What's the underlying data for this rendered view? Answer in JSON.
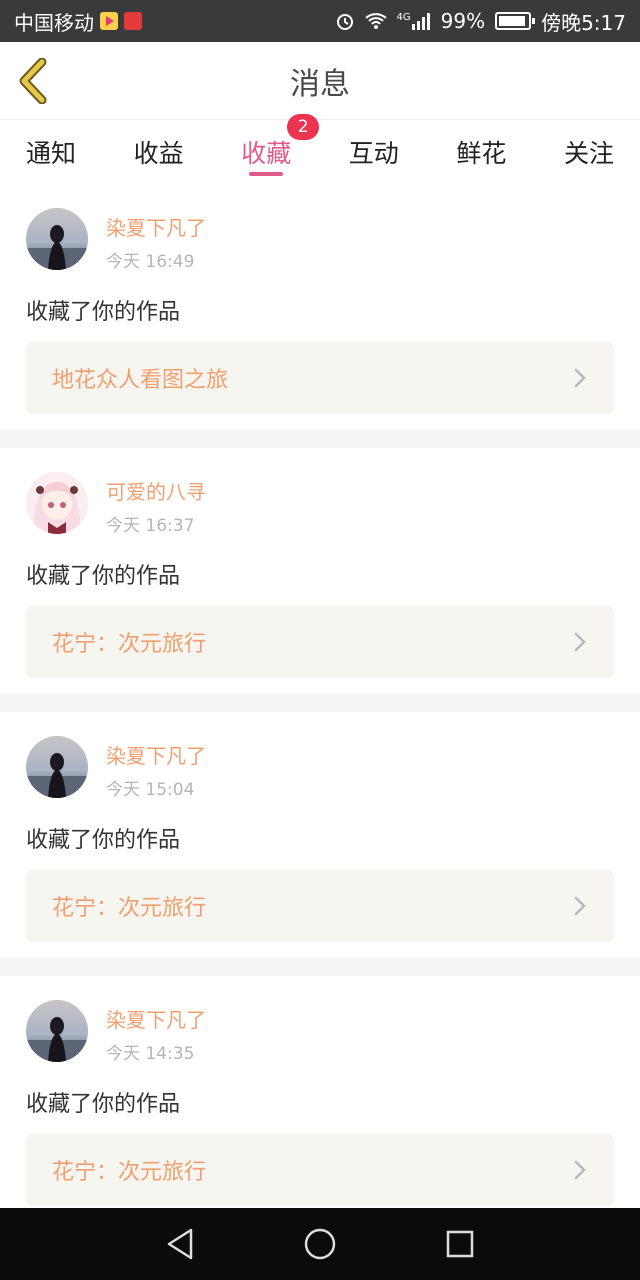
{
  "status_bar": {
    "carrier": "中国移动",
    "network": "4G",
    "battery": "99%",
    "time": "傍晚5:17"
  },
  "header": {
    "title": "消息"
  },
  "tabs": [
    {
      "label": "通知"
    },
    {
      "label": "收益"
    },
    {
      "label": "收藏",
      "badge": "2",
      "active": true
    },
    {
      "label": "互动"
    },
    {
      "label": "鲜花"
    },
    {
      "label": "关注"
    }
  ],
  "feed": [
    {
      "username": "染夏下凡了",
      "time": "今天 16:49",
      "action": "收藏了你的作品",
      "work": "地花众人看图之旅"
    },
    {
      "username": "可爱的八寻",
      "time": "今天 16:37",
      "action": "收藏了你的作品",
      "work": "花宁：次元旅行"
    },
    {
      "username": "染夏下凡了",
      "time": "今天 15:04",
      "action": "收藏了你的作品",
      "work": "花宁：次元旅行"
    },
    {
      "username": "染夏下凡了",
      "time": "今天 14:35",
      "action": "收藏了你的作品",
      "work": "花宁：次元旅行"
    }
  ],
  "colors": {
    "accent_pink": "#e25a8c",
    "username_orange": "#f0a070",
    "badge_red": "#ee3350",
    "back_arrow_yellow": "#e8c84a"
  }
}
